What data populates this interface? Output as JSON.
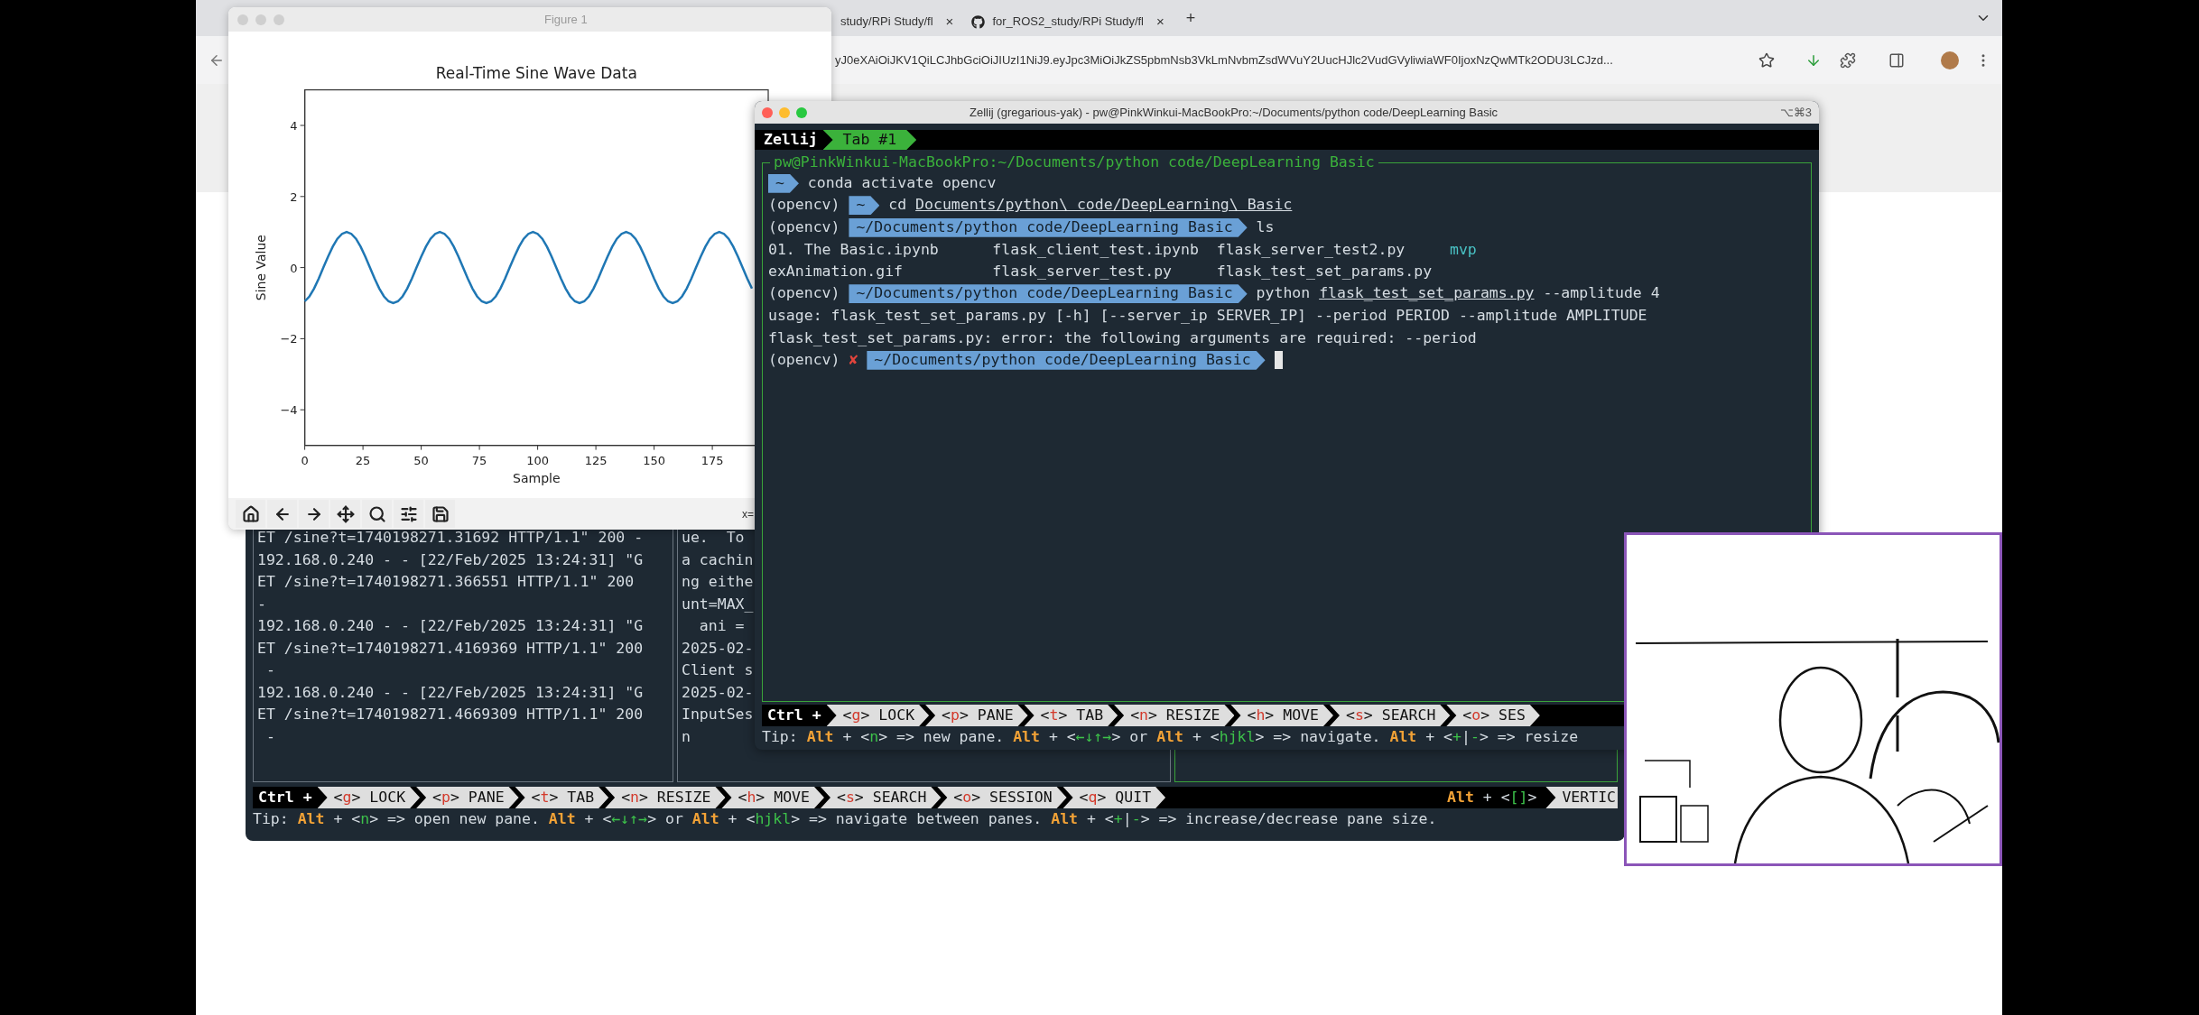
{
  "browser": {
    "tabs": [
      {
        "kind": "plain",
        "title": "study/RPi Study/fl",
        "close": "×",
        "selected": false
      },
      {
        "kind": "github",
        "title": "for_ROS2_study/RPi Study/fl",
        "close": "×",
        "selected": false
      }
    ],
    "new_tab": "+",
    "url": "yJ0eXAiOiJKV1QiLCJhbGciOiJIUzI1NiJ9.eyJpc3MiOiJkZS5pbmNsb3VkLmNvbmZsdWVuY2UucHJlc2VudGVyliwiaWF0IjoxNzQwMTk2ODU3LCJzd..."
  },
  "figure_window": {
    "title": "Figure 1",
    "coordinates": "x=",
    "chart_data": {
      "type": "line",
      "title": "Real-Time Sine Wave Data",
      "xlabel": "Sample",
      "ylabel": "Sine Value",
      "xlim": [
        0,
        199
      ],
      "ylim": [
        -5,
        5
      ],
      "xticks": [
        0,
        25,
        50,
        75,
        100,
        125,
        150,
        175
      ],
      "yticks": [
        {
          "value": -4,
          "label": "−4"
        },
        {
          "value": -2,
          "label": "−2"
        },
        {
          "value": 0,
          "label": "0"
        },
        {
          "value": 2,
          "label": "2"
        },
        {
          "value": 4,
          "label": "4"
        }
      ],
      "x": [
        0,
        2,
        4,
        6,
        8,
        10,
        12,
        14,
        16,
        18,
        20,
        22,
        24,
        26,
        28,
        30,
        32,
        34,
        36,
        38,
        40,
        42,
        44,
        46,
        48,
        50,
        52,
        54,
        56,
        58,
        60,
        62,
        64,
        66,
        68,
        70,
        72,
        74,
        76,
        78,
        80,
        82,
        84,
        86,
        88,
        90,
        92,
        94,
        96,
        98,
        100,
        102,
        104,
        106,
        108,
        110,
        112,
        114,
        116,
        118,
        120,
        122,
        124,
        126,
        128,
        130,
        132,
        134,
        136,
        138,
        140,
        142,
        144,
        146,
        148,
        150,
        152,
        154,
        156,
        158,
        160,
        162,
        164,
        166,
        168,
        170,
        172,
        174,
        176,
        178,
        180,
        182,
        184,
        186,
        188,
        190,
        192
      ],
      "series": [
        {
          "color": "#1f77b4",
          "values": [
            -0.95,
            -0.81,
            -0.59,
            -0.31,
            0,
            0.31,
            0.59,
            0.81,
            0.95,
            1,
            0.95,
            0.81,
            0.59,
            0.31,
            0,
            -0.31,
            -0.59,
            -0.81,
            -0.95,
            -1,
            -0.95,
            -0.81,
            -0.59,
            -0.31,
            0,
            0.31,
            0.59,
            0.81,
            0.95,
            1,
            0.95,
            0.81,
            0.59,
            0.31,
            0,
            -0.31,
            -0.59,
            -0.81,
            -0.95,
            -1,
            -0.95,
            -0.81,
            -0.59,
            -0.31,
            0,
            0.31,
            0.59,
            0.81,
            0.95,
            1,
            0.95,
            0.81,
            0.59,
            0.31,
            0,
            -0.31,
            -0.59,
            -0.81,
            -0.95,
            -1,
            -0.95,
            -0.81,
            -0.59,
            -0.31,
            0,
            0.31,
            0.59,
            0.81,
            0.95,
            1,
            0.95,
            0.81,
            0.59,
            0.31,
            0,
            -0.31,
            -0.59,
            -0.81,
            -0.95,
            -1,
            -0.95,
            -0.81,
            -0.59,
            -0.31,
            0,
            0.31,
            0.59,
            0.81,
            0.95,
            1,
            0.95,
            0.81,
            0.59,
            0.31,
            0,
            -0.31,
            -0.59
          ]
        }
      ]
    }
  },
  "terminal_back": {
    "panes": [
      {
        "focused": false,
        "lines": [
          "ET /sine?t=1740198271.31692 HTTP/1.1\" 200 -",
          "192.168.0.240 - - [22/Feb/2025 13:24:31] \"G",
          "ET /sine?t=1740198271.366551 HTTP/1.1\" 200",
          "-",
          "192.168.0.240 - - [22/Feb/2025 13:24:31] \"G",
          "ET /sine?t=1740198271.4169369 HTTP/1.1\" 200",
          " -",
          "192.168.0.240 - - [22/Feb/2025 13:24:31] \"G",
          "ET /sine?t=1740198271.4669309 HTTP/1.1\" 200",
          " -"
        ]
      },
      {
        "focused": false,
        "lines": [
          "ue.  To",
          "a cachin",
          "ng eithe",
          "unt=MAX_",
          "  ani =",
          "2025-02-",
          "Client s",
          "2025-02-",
          "InputSes",
          "n"
        ]
      },
      {
        "focused": true
      }
    ],
    "status_bar": {
      "modifier": "Ctrl +",
      "keys": [
        {
          "before": "<",
          "key": "g",
          "after": "> LOCK"
        },
        {
          "before": "<",
          "key": "p",
          "after": "> PANE"
        },
        {
          "before": "<",
          "key": "t",
          "after": "> TAB"
        },
        {
          "before": "<",
          "key": "n",
          "after": "> RESIZE"
        },
        {
          "before": "<",
          "key": "h",
          "after": "> MOVE"
        },
        {
          "before": "<",
          "key": "s",
          "after": "> SEARCH"
        },
        {
          "before": "<",
          "key": "o",
          "after": "> SESSION"
        },
        {
          "before": "<",
          "key": "q",
          "after": "> QUIT"
        }
      ],
      "right": [
        {
          "kind": "alt",
          "text": "Alt"
        },
        {
          "kind": "text",
          "text": " + <"
        },
        {
          "kind": "key",
          "text": "[]"
        },
        {
          "kind": "text",
          "text": ">"
        }
      ],
      "mode": "VERTIC",
      "tip": [
        {
          "kind": "text",
          "text": "Tip: "
        },
        {
          "kind": "alt",
          "text": "Alt"
        },
        {
          "kind": "text",
          "text": " + <"
        },
        {
          "kind": "key",
          "text": "n"
        },
        {
          "kind": "text",
          "text": "> => open new pane. "
        },
        {
          "kind": "alt",
          "text": "Alt"
        },
        {
          "kind": "text",
          "text": " + <"
        },
        {
          "kind": "key",
          "text": "←↓↑→"
        },
        {
          "kind": "text",
          "text": "> or "
        },
        {
          "kind": "alt",
          "text": "Alt"
        },
        {
          "kind": "text",
          "text": " + <"
        },
        {
          "kind": "key",
          "text": "hjkl"
        },
        {
          "kind": "text",
          "text": "> => navigate between panes. "
        },
        {
          "kind": "alt",
          "text": "Alt"
        },
        {
          "kind": "text",
          "text": " + <"
        },
        {
          "kind": "key",
          "text": "+"
        },
        {
          "kind": "text",
          "text": "|"
        },
        {
          "kind": "key",
          "text": "-"
        },
        {
          "kind": "text",
          "text": "> => increase/decrease pane size."
        }
      ]
    }
  },
  "terminal_front": {
    "title": "Zellij (gregarious-yak) - pw@PinkWinkui-MacBookPro:~/Documents/python code/DeepLearning Basic",
    "shortcut": "⌥⌘3",
    "app_label": "Zellij",
    "tabs": [
      {
        "label": "Tab #1",
        "selected": true
      }
    ],
    "pane": {
      "title": "pw@PinkWinkui-MacBookPro:~/Documents/python code/DeepLearning Basic",
      "focused": true,
      "lines": [
        [
          {
            "kind": "prompt",
            "text": "~"
          },
          {
            "kind": "text",
            "text": " conda activate opencv"
          }
        ],
        [
          {
            "kind": "text",
            "text": "(opencv) "
          },
          {
            "kind": "prompt",
            "text": "~"
          },
          {
            "kind": "text",
            "text": " cd "
          },
          {
            "kind": "path",
            "text": "Documents/python\\ code/DeepLearning\\ Basic"
          }
        ],
        [
          {
            "kind": "text",
            "text": "(opencv) "
          },
          {
            "kind": "prompt",
            "text": "~/Documents/python code/DeepLearning Basic"
          },
          {
            "kind": "text",
            "text": " ls"
          }
        ],
        [
          {
            "kind": "text",
            "text": "01. The Basic.ipynb      flask_client_test.ipynb  flask_server_test2.py     "
          },
          {
            "kind": "dir",
            "text": "mvp"
          }
        ],
        [
          {
            "kind": "text",
            "text": "exAnimation.gif          flask_server_test.py     flask_test_set_params.py"
          }
        ],
        [
          {
            "kind": "text",
            "text": "(opencv) "
          },
          {
            "kind": "prompt",
            "text": "~/Documents/python code/DeepLearning Basic"
          },
          {
            "kind": "text",
            "text": " python "
          },
          {
            "kind": "path",
            "text": "flask_test_set_params.py"
          },
          {
            "kind": "text",
            "text": " --amplitude 4"
          }
        ],
        [
          {
            "kind": "text",
            "text": "usage: flask_test_set_params.py [-h] [--server_ip SERVER_IP] --period PERIOD --amplitude AMPLITUDE"
          }
        ],
        [
          {
            "kind": "text",
            "text": "flask_test_set_params.py: error: the following arguments are required: --period"
          }
        ],
        [
          {
            "kind": "text",
            "text": "(opencv) "
          },
          {
            "kind": "error",
            "text": "✘"
          },
          {
            "kind": "prompt",
            "text": "~/Documents/python code/DeepLearning Basic"
          },
          {
            "kind": "cursor"
          }
        ]
      ]
    },
    "status_bar": {
      "modifier": "Ctrl +",
      "keys": [
        {
          "before": "<",
          "key": "g",
          "after": "> LOCK"
        },
        {
          "before": "<",
          "key": "p",
          "after": "> PANE"
        },
        {
          "before": "<",
          "key": "t",
          "after": "> TAB"
        },
        {
          "before": "<",
          "key": "n",
          "after": "> RESIZE"
        },
        {
          "before": "<",
          "key": "h",
          "after": "> MOVE"
        },
        {
          "before": "<",
          "key": "s",
          "after": "> SEARCH"
        },
        {
          "before": "<",
          "key": "o",
          "after": "> SES"
        }
      ],
      "tip": [
        {
          "kind": "text",
          "text": "Tip: "
        },
        {
          "kind": "alt",
          "text": "Alt"
        },
        {
          "kind": "text",
          "text": " + <"
        },
        {
          "kind": "key",
          "text": "n"
        },
        {
          "kind": "text",
          "text": "> => new pane. "
        },
        {
          "kind": "alt",
          "text": "Alt"
        },
        {
          "kind": "text",
          "text": " + <"
        },
        {
          "kind": "key",
          "text": "←↓↑→"
        },
        {
          "kind": "text",
          "text": "> or "
        },
        {
          "kind": "alt",
          "text": "Alt"
        },
        {
          "kind": "text",
          "text": " + <"
        },
        {
          "kind": "key",
          "text": "hjkl"
        },
        {
          "kind": "text",
          "text": "> => navigate. "
        },
        {
          "kind": "alt",
          "text": "Alt"
        },
        {
          "kind": "text",
          "text": " + <"
        },
        {
          "kind": "key",
          "text": "+"
        },
        {
          "kind": "text",
          "text": "|"
        },
        {
          "kind": "key",
          "text": "-"
        },
        {
          "kind": "text",
          "text": "> => resize"
        }
      ]
    }
  }
}
